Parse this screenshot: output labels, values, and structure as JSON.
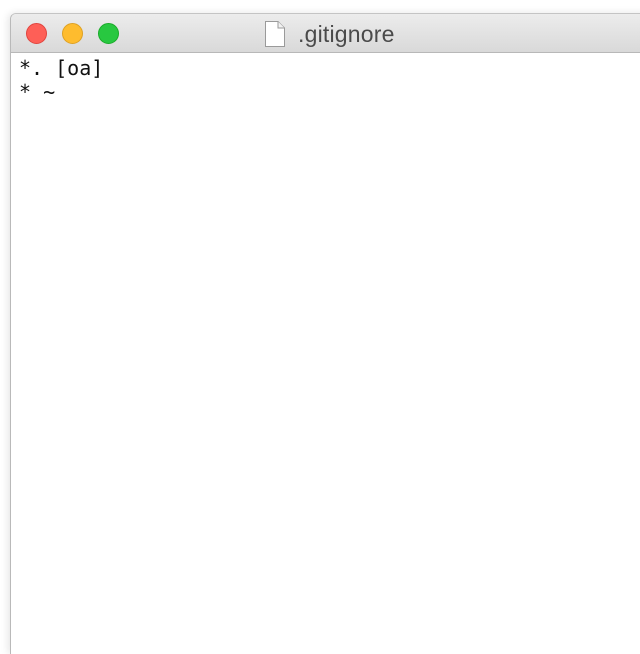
{
  "window": {
    "title": ".gitignore",
    "title_icon": "document-icon",
    "controls": {
      "close": {
        "color": "#fe5f57"
      },
      "minimize": {
        "color": "#febc2e"
      },
      "zoom": {
        "color": "#28c840"
      }
    }
  },
  "editor": {
    "lines": [
      "*. [oa]",
      "* ~"
    ]
  }
}
